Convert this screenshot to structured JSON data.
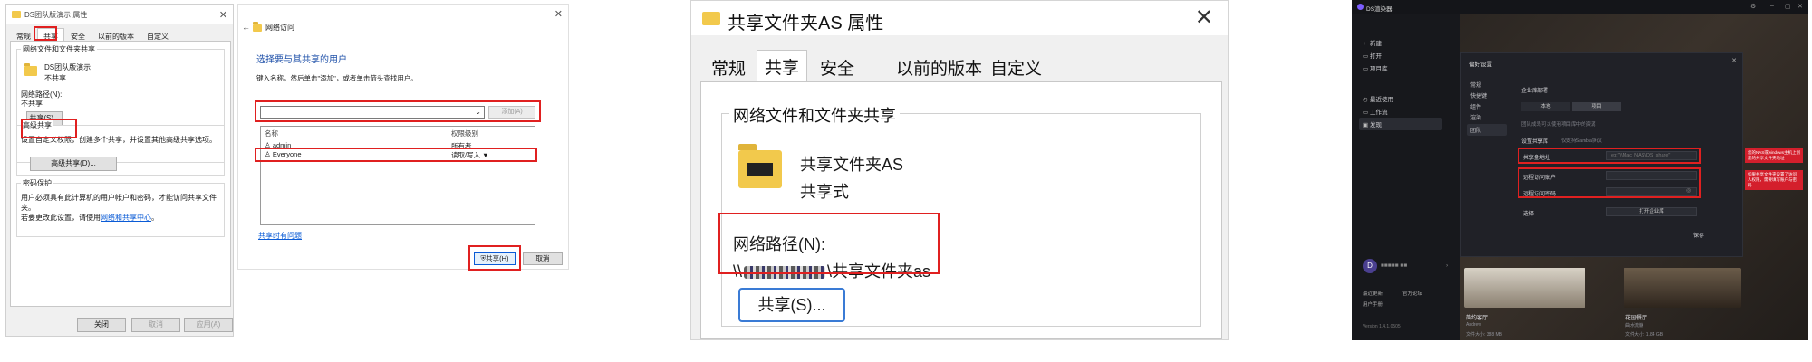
{
  "panel1": {
    "title": "DS团队版演示 属性",
    "tabs": [
      "常规",
      "共享",
      "安全",
      "以前的版本",
      "自定义"
    ],
    "active_tab": "共享",
    "group_network": "网络文件和文件夹共享",
    "folder_name": "DS团队版演示",
    "folder_state": "不共享",
    "path_label": "网络路径(N):",
    "path_value": "不共享",
    "share_button": "共享(S)...",
    "group_advanced": "高级共享",
    "advanced_desc": "设置自定义权限，创建多个共享，并设置其他高级共享选项。",
    "advanced_button": "高级共享(D)...",
    "group_password": "密码保护",
    "password_desc": "用户必须具有此计算机的用户帐户和密码，才能访问共享文件夹。",
    "password_link_prefix": "若要更改此设置，请使用",
    "password_link": "网络和共享中心",
    "password_link_suffix": "。",
    "btn_close": "关闭",
    "btn_cancel": "取消",
    "btn_apply": "应用(A)"
  },
  "panel2": {
    "window_title": "网络访问",
    "heading": "选择要与其共享的用户",
    "desc": "键入名称，然后单击\"添加\"，或者单击箭头查找用户。",
    "add_button": "添加(A)",
    "col_name": "名称",
    "col_level": "权限级别",
    "rows": [
      {
        "name": "admin",
        "level": "所有者"
      },
      {
        "name": "Everyone",
        "level": "读取/写入 ▼"
      }
    ],
    "help_link": "共享时有问题",
    "share_button": "共享(H)",
    "cancel_button": "取消"
  },
  "panel3": {
    "title": "共享文件夹AS 属性",
    "tabs": [
      "常规",
      "共享",
      "安全",
      "以前的版本",
      "自定义"
    ],
    "active_tab": "共享",
    "group_title": "网络文件和文件夹共享",
    "folder_name": "共享文件夹AS",
    "folder_state": "共享式",
    "path_label": "网络路径(N):",
    "path_prefix": "\\\\",
    "path_suffix": "\\共享文件夹as",
    "share_button": "共享(S)..."
  },
  "panel4": {
    "app_title": "DS渲染器",
    "sidebar": [
      {
        "icon": "+",
        "label": "新建"
      },
      {
        "icon": "▭",
        "label": "打开"
      },
      {
        "icon": "▭",
        "label": "项目库"
      },
      {
        "icon": "◷",
        "label": "最近使用"
      },
      {
        "icon": "▭",
        "label": "工作流"
      },
      {
        "icon": "▣",
        "label": "发现"
      }
    ],
    "modal_title": "偏好设置",
    "modal_nav": [
      "常规",
      "快捷键",
      "组件",
      "渲染",
      "团队"
    ],
    "modal_active": "团队",
    "section_title": "企业库部署",
    "seg_local": "本地",
    "seg_project": "项目",
    "hint1": "团队成员可以使用项目库中的资源",
    "share_address_label": "设置共享库",
    "share_address_hint": "仅支持Samba协议",
    "addr_label": "共享盘地址",
    "addr_placeholder": "eg:\"\\\\Mac_NAS\\DS_share\"",
    "user_label": "远程访问账户",
    "pass_label": "远程访问密码",
    "choose_label": "选择",
    "open_btn": "打开企业库",
    "save_btn": "保存",
    "callout1": "您的NAS或windows主机上创建的共享文件夹地址",
    "callout2": "如果共享文件夹设置了访问人权限，需要填写账户与密码",
    "avatar_letter": "D",
    "avatar_name": "■■■■■ ■■",
    "side_bottom": [
      "最近更新",
      "官方论坛",
      "用户手册"
    ],
    "version": "Version 1.4.1.0505",
    "cards": [
      {
        "title": "简约客厅",
        "sub": "Andrew",
        "meta": "文件大小: 388 MB"
      },
      {
        "title": "花园餐厅",
        "sub": "曲水流觞",
        "meta": "文件大小: 1.84 GB"
      }
    ]
  }
}
